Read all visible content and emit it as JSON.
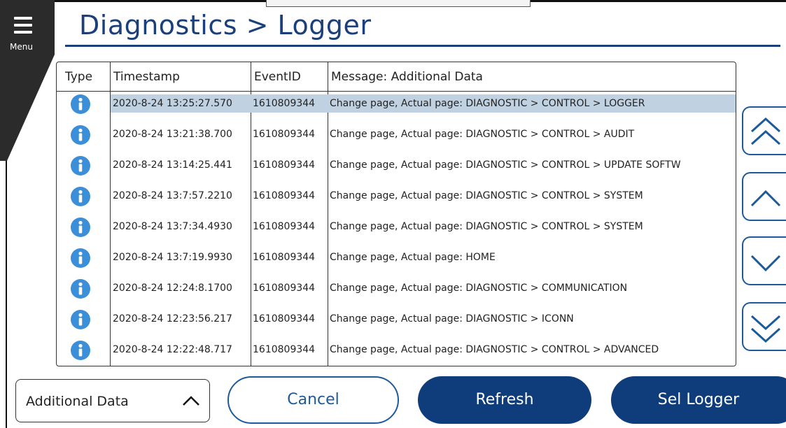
{
  "header": {
    "title": "Diagnostics > Logger",
    "menu_label": "Menu"
  },
  "table": {
    "columns": [
      "Type",
      "Timestamp",
      "EventID",
      "Message: Additional Data"
    ],
    "rows": [
      {
        "type_icon": "info-icon",
        "timestamp": "2020-8-24 13:25:27.570",
        "event_id": "1610809344",
        "message": "Change page, Actual page: DIAGNOSTIC > CONTROL > LOGGER",
        "selected": true
      },
      {
        "type_icon": "info-icon",
        "timestamp": "2020-8-24 13:21:38.700",
        "event_id": "1610809344",
        "message": "Change page, Actual page: DIAGNOSTIC > CONTROL > AUDIT"
      },
      {
        "type_icon": "info-icon",
        "timestamp": "2020-8-24 13:14:25.441",
        "event_id": "1610809344",
        "message": "Change page, Actual page: DIAGNOSTIC > CONTROL > UPDATE SOFTW"
      },
      {
        "type_icon": "info-icon",
        "timestamp": "2020-8-24 13:7:57.2210",
        "event_id": "1610809344",
        "message": "Change page, Actual page: DIAGNOSTIC > CONTROL > SYSTEM"
      },
      {
        "type_icon": "info-icon",
        "timestamp": "2020-8-24 13:7:34.4930",
        "event_id": "1610809344",
        "message": "Change page, Actual page: DIAGNOSTIC > CONTROL > SYSTEM"
      },
      {
        "type_icon": "info-icon",
        "timestamp": "2020-8-24 13:7:19.9930",
        "event_id": "1610809344",
        "message": "Change page, Actual page: HOME"
      },
      {
        "type_icon": "info-icon",
        "timestamp": "2020-8-24 12:24:8.1700",
        "event_id": "1610809344",
        "message": "Change page, Actual page: DIAGNOSTIC > COMMUNICATION"
      },
      {
        "type_icon": "info-icon",
        "timestamp": "2020-8-24 12:23:56.217",
        "event_id": "1610809344",
        "message": "Change page, Actual page: DIAGNOSTIC > ICONN"
      },
      {
        "type_icon": "info-icon",
        "timestamp": "2020-8-24 12:22:48.717",
        "event_id": "1610809344",
        "message": "Change page, Actual page: DIAGNOSTIC > CONTROL > ADVANCED"
      }
    ]
  },
  "scroll": {
    "buttons": [
      "double-chevron-up-icon",
      "chevron-up-icon",
      "chevron-down-icon",
      "double-chevron-down-icon"
    ]
  },
  "footer": {
    "select_value": "Additional Data",
    "cancel_label": "Cancel",
    "refresh_label": "Refresh",
    "sel_logger_label": "Sel Logger"
  },
  "colors": {
    "title_blue": "#1a3f7a",
    "button_navy": "#0f3d7c",
    "outline_blue": "#1c5a9a",
    "info_blue": "#3b8fd8",
    "selected_row": "#c0d2e2"
  }
}
